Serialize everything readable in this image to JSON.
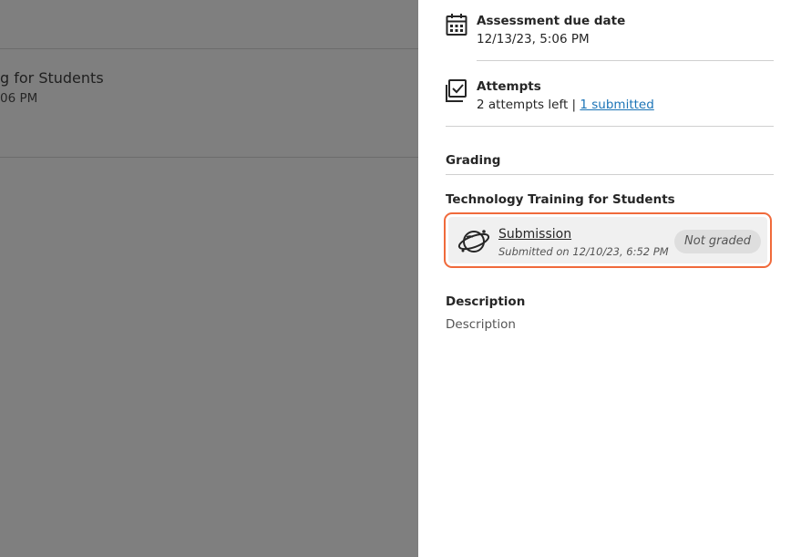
{
  "background": {
    "title_fragment": "g for Students",
    "subtitle_fragment": "06 PM"
  },
  "panel": {
    "due_date": {
      "icon": "calendar-icon",
      "label": "Assessment due date",
      "value": "12/13/23, 5:06 PM"
    },
    "attempts": {
      "icon": "checkbox-icon",
      "label": "Attempts",
      "left_text": "2 attempts left",
      "separator": " | ",
      "submitted_link": "1 submitted"
    },
    "grading": {
      "heading": "Grading",
      "course_title": "Technology Training for Students",
      "submission": {
        "icon": "planet-icon",
        "title": "Submission",
        "submitted_on": "Submitted on 12/10/23, 6:52 PM",
        "status": "Not graded"
      }
    },
    "description": {
      "heading": "Description",
      "text": "Description"
    }
  },
  "colors": {
    "highlight_border": "#f06a3b",
    "link": "#1a73b6",
    "overlay": "#7f7f7f"
  }
}
